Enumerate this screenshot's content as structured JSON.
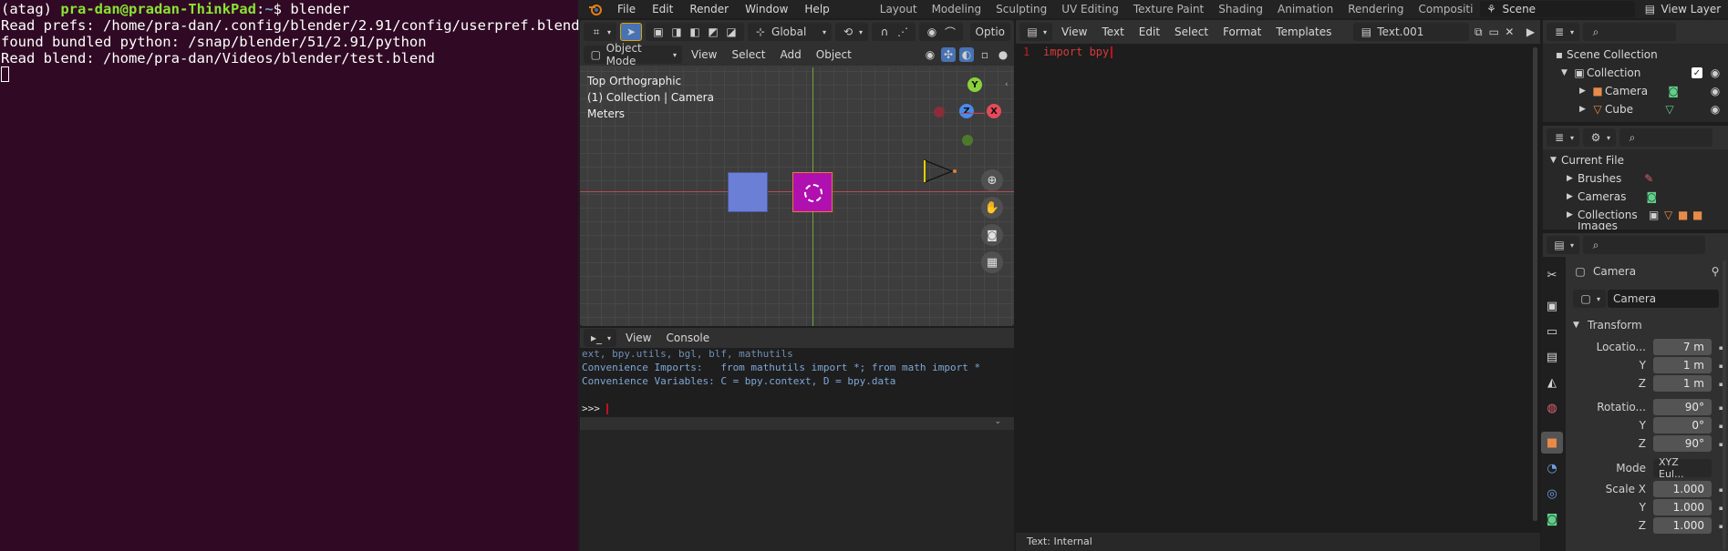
{
  "terminal": {
    "prompt_env": "(atag) ",
    "prompt_user": "pra-dan@pradan-ThinkPad",
    "prompt_sep": ":",
    "prompt_path": "~",
    "prompt_end": "$ blender",
    "lines": [
      "Read prefs: /home/pra-dan/.config/blender/2.91/config/userpref.blend",
      "found bundled python: /snap/blender/51/2.91/python",
      "Read blend: /home/pra-dan/Videos/blender/test.blend"
    ]
  },
  "topbar": {
    "menus": [
      "File",
      "Edit",
      "Render",
      "Window",
      "Help"
    ],
    "workspaces": [
      "Layout",
      "Modeling",
      "Sculpting",
      "UV Editing",
      "Texture Paint",
      "Shading",
      "Animation",
      "Rendering",
      "Compositi"
    ],
    "scene": "Scene",
    "view_layer": "View Layer"
  },
  "viewport": {
    "transform_orientation": "Global",
    "options_label": "Optio",
    "mode": "Object Mode",
    "menus": [
      "View",
      "Select",
      "Add",
      "Object"
    ],
    "overlay_lines": [
      "Top Orthographic",
      "(1) Collection | Camera",
      "Meters"
    ],
    "gizmo": {
      "y": "Y",
      "z": "Z",
      "x": "X"
    }
  },
  "console": {
    "menus": [
      "View",
      "Console"
    ],
    "lines": [
      "ext, bpy.utils, bgl, blf, mathutils",
      "Convenience Imports:   from mathutils import *; from math import *",
      "Convenience Variables: C = bpy.context, D = bpy.data",
      "",
      ">>> "
    ]
  },
  "text_editor": {
    "menus": [
      "View",
      "Text",
      "Edit",
      "Select",
      "Format",
      "Templates"
    ],
    "text_name": "Text.001",
    "line_number": "1",
    "code_line": "import bpy",
    "status": "Text: Internal"
  },
  "outliner": {
    "scene_collection": "Scene Collection",
    "collection": "Collection",
    "items": [
      "Camera",
      "Cube"
    ]
  },
  "file_browser": {
    "current_file": "Current File",
    "items": [
      "Brushes",
      "Cameras",
      "Collections",
      "Images"
    ]
  },
  "properties": {
    "object_name": "Camera",
    "data_name": "Camera",
    "section": "Transform",
    "location_label": "Locatio...",
    "location": [
      "7 m",
      "1 m",
      "1 m"
    ],
    "rotation_label": "Rotatio...",
    "rotation": [
      "90°",
      "0°",
      "90°"
    ],
    "mode_label": "Mode",
    "mode_value": "XYZ Eul...",
    "scale_label": "Scale X",
    "scale": [
      "1.000",
      "1.000",
      "1.000"
    ],
    "axis_y": "Y",
    "axis_z": "Z"
  },
  "colors": {
    "terminal_bg": "#300a24",
    "accent": "#4772b3",
    "selected_object": "#b010b0",
    "cube": "#6b7fd7",
    "x_axis": "#e64a5a",
    "y_axis": "#7cc940"
  }
}
